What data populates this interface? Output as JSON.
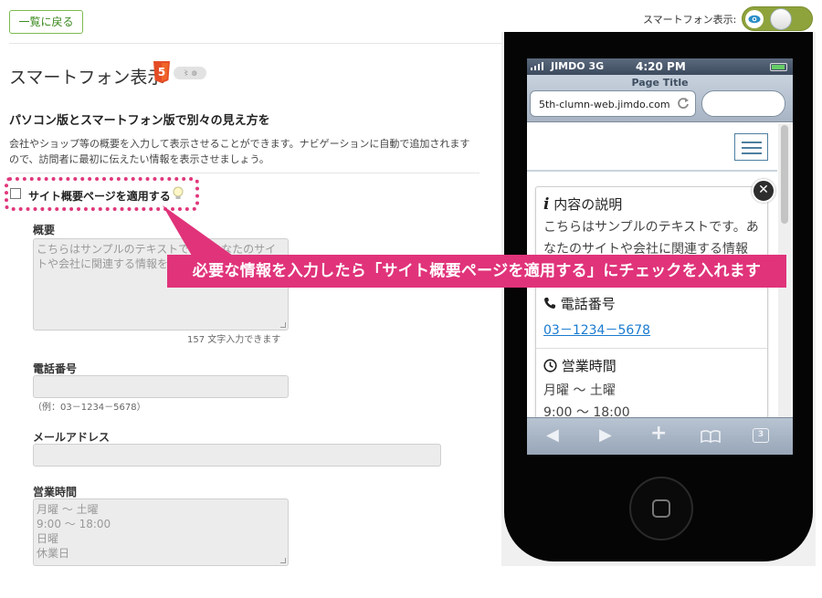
{
  "top_bar": {
    "back_label": "一覧に戻る",
    "smartphone_display_label": "スマートフォン表示:"
  },
  "settings": {
    "title": "スマートフォン表示",
    "html5_label": "5",
    "heading": "パソコン版とスマートフォン版で別々の見え方を",
    "description": "会社やショップ等の概要を入力して表示させることができます。ナビゲーションに自動で追加されますので、訪問者に最初に伝えたい情報を表示させましょう。",
    "apply_checkbox_label": "サイト概要ページを適用する",
    "fields": {
      "overview_label": "概要",
      "overview_value": "こちらはサンプルのテキストです。あなたのサイトや会社に関連する情報を入力してください。",
      "chars_remaining": "157 文字入力できます",
      "phone_label": "電話番号",
      "phone_hint": "（例：03－1234－5678）",
      "email_label": "メールアドレス",
      "hours_label": "営業時間",
      "hours_lines": [
        "月曜 ～ 土曜",
        "9:00 ～ 18:00",
        "日曜",
        "休業日"
      ]
    }
  },
  "callout": {
    "text": "必要な情報を入力したら「サイト概要ページを適用する」にチェックを入れます"
  },
  "phone_preview": {
    "status": {
      "carrier": "JIMDO",
      "network": "3G",
      "time": "4:20 PM"
    },
    "page_title": "Page Title",
    "url": "5th-clumn-web.jimdo.com",
    "card": {
      "info_title": "内容の説明",
      "info_text": "こちらはサンプルのテキストです。あなたのサイトや会社に関連する情報",
      "phone_title": "電話番号",
      "phone_number": "03－1234－5678",
      "hours_title": "営業時間",
      "hours_line1": "月曜 ～ 土曜",
      "hours_line2": "9:00 ～ 18:00"
    },
    "toolbar": {
      "tabs_count": "3"
    }
  },
  "colors": {
    "accent_green": "#8ea33c",
    "callout_magenta": "#e0337a",
    "link_blue": "#1a7bd0"
  }
}
